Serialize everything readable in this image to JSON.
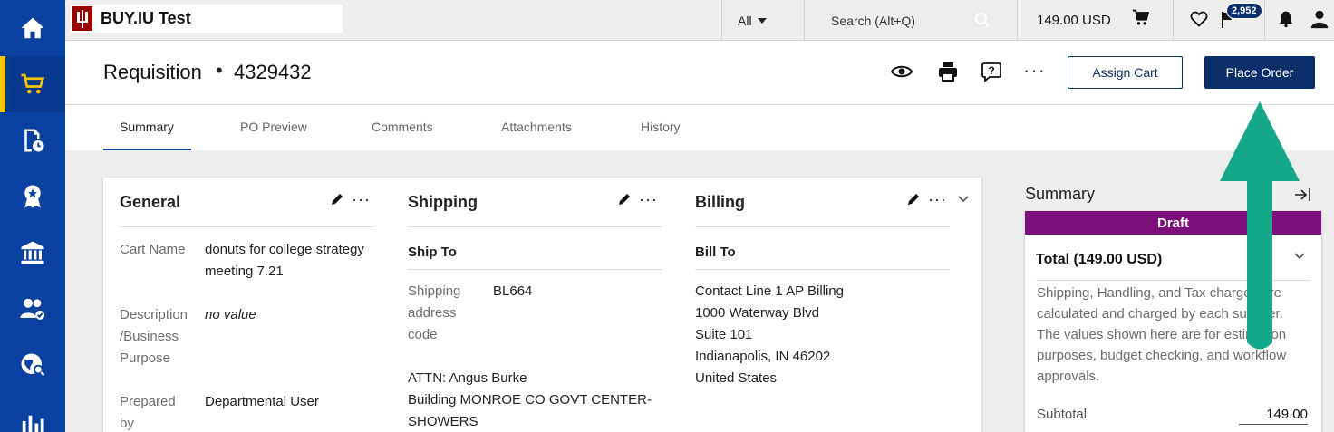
{
  "topbar": {
    "app_name": "BUY.IU Test",
    "search_scope": "All",
    "search_placeholder": "Search (Alt+Q)",
    "cart_total": "149.00 USD",
    "notification_badge": "2,952"
  },
  "header": {
    "title": "Requisition",
    "separator": "•",
    "number": "4329432",
    "assign_cart_label": "Assign Cart",
    "place_order_label": "Place Order"
  },
  "tabs": [
    {
      "label": "Summary",
      "active": true
    },
    {
      "label": "PO Preview"
    },
    {
      "label": "Comments"
    },
    {
      "label": "Attachments"
    },
    {
      "label": "History"
    }
  ],
  "general": {
    "heading": "General",
    "cart_name_label": "Cart Name",
    "cart_name_line1": "donuts for college strategy",
    "cart_name_line2": "meeting 7.21",
    "description_label_1": "Description",
    "description_label_2": "/Business",
    "description_label_3": "Purpose",
    "description_value": "no value",
    "prepared_by_label_1": "Prepared",
    "prepared_by_label_2": "by",
    "prepared_by_value": "Departmental User"
  },
  "shipping": {
    "heading": "Shipping",
    "ship_to_label": "Ship To",
    "address_code_label_1": "Shipping",
    "address_code_label_2": "address",
    "address_code_label_3": "code",
    "address_code_value": "BL664",
    "attn": "ATTN: Angus Burke",
    "building_line1": "Building MONROE CO GOVT CENTER-",
    "building_line2": "SHOWERS"
  },
  "billing": {
    "heading": "Billing",
    "bill_to_label": "Bill To",
    "lines": [
      "Contact Line 1 AP Billing",
      "1000 Waterway Blvd",
      "Suite 101",
      "Indianapolis, IN 46202",
      "United States"
    ]
  },
  "summary": {
    "heading": "Summary",
    "status": "Draft",
    "total": "Total (149.00 USD)",
    "note": "Shipping, Handling, and Tax charges are calculated and charged by each supplier. The values shown here are for estimation purposes, budget checking, and workflow approvals.",
    "subtotal_label": "Subtotal",
    "subtotal_value": "149.00"
  },
  "colors": {
    "nav_bg": "#0a41a0",
    "nav_active_accent": "#f6c400",
    "primary_button": "#0b2f6b",
    "draft_status": "#7c0f7c",
    "annotation_arrow": "#12a88a"
  }
}
